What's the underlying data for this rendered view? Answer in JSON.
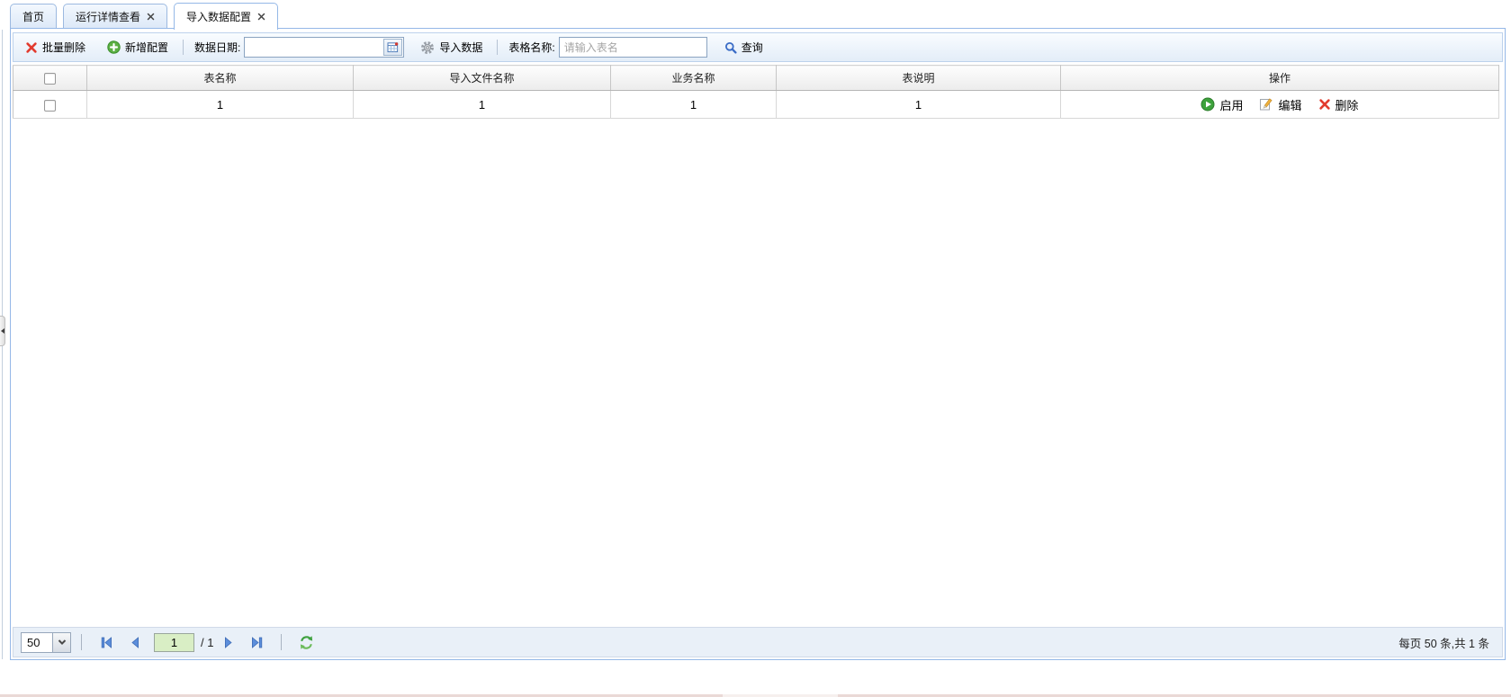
{
  "tabs": [
    {
      "label": "首页",
      "closable": false,
      "active": false
    },
    {
      "label": "运行详情查看",
      "closable": true,
      "active": false
    },
    {
      "label": "导入数据配置",
      "closable": true,
      "active": true
    }
  ],
  "toolbar": {
    "batch_delete_label": "批量删除",
    "add_config_label": "新增配置",
    "date_label": "数据日期:",
    "date_value": "",
    "import_data_label": "导入数据",
    "table_name_label": "表格名称:",
    "table_name_placeholder": "请输入表名",
    "table_name_value": "",
    "search_label": "查询"
  },
  "grid": {
    "columns": [
      {
        "label": "表名称"
      },
      {
        "label": "导入文件名称"
      },
      {
        "label": "业务名称"
      },
      {
        "label": "表说明"
      },
      {
        "label": "操作"
      }
    ],
    "rows": [
      {
        "checked": false,
        "table_name": "1",
        "import_file_name": "1",
        "business_name": "1",
        "table_desc": "1",
        "actions": {
          "enable_label": "启用",
          "edit_label": "编辑",
          "delete_label": "删除"
        }
      }
    ]
  },
  "pagination": {
    "page_size": "50",
    "current_page": "1",
    "total_pages_text": "/ 1",
    "summary": "每页 50 条,共 1 条"
  },
  "icons": {
    "batch_delete": "red-x-icon",
    "add_config": "green-plus-circle-icon",
    "date_picker": "calendar-icon",
    "import_data": "gear-icon",
    "search": "magnifier-icon",
    "row_enable": "green-play-circle-icon",
    "row_edit": "pencil-icon",
    "row_delete": "red-x-icon",
    "pager_refresh": "green-refresh-icon",
    "west_collapse": "left-arrow-handle"
  },
  "colors": {
    "panel_border": "#95b8e7",
    "tab_border": "#9cb9e0",
    "toolbar_bg": "#eef4fb",
    "pager_bg": "#e9f0f8",
    "page_input_bg": "#d9eec5",
    "pager_arrow_blue": "#5c8edb",
    "action_green": "#3da23c",
    "danger_red": "#e23b2e",
    "pencil_orange": "#f2b33d"
  }
}
